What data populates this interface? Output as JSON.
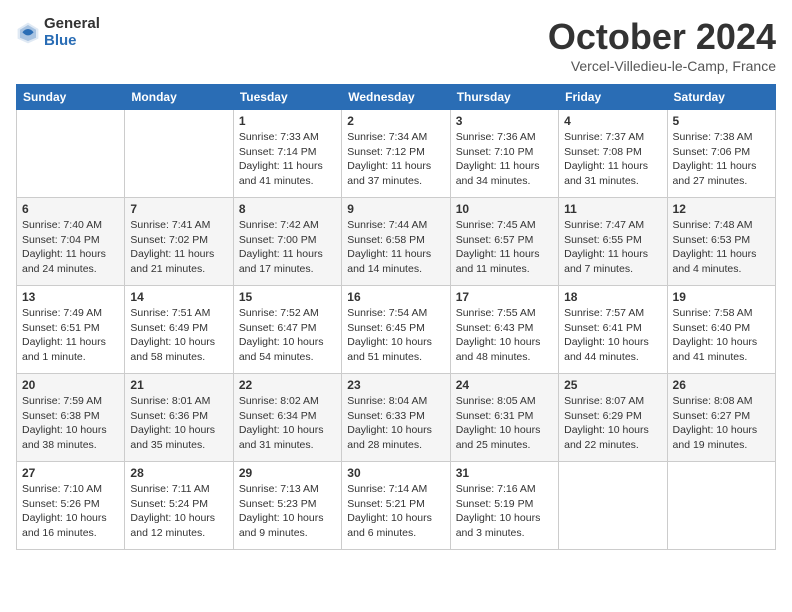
{
  "header": {
    "logo_general": "General",
    "logo_blue": "Blue",
    "month_title": "October 2024",
    "location": "Vercel-Villedieu-le-Camp, France"
  },
  "columns": [
    "Sunday",
    "Monday",
    "Tuesday",
    "Wednesday",
    "Thursday",
    "Friday",
    "Saturday"
  ],
  "weeks": [
    [
      {
        "day": "",
        "info": ""
      },
      {
        "day": "",
        "info": ""
      },
      {
        "day": "1",
        "info": "Sunrise: 7:33 AM\nSunset: 7:14 PM\nDaylight: 11 hours and 41 minutes."
      },
      {
        "day": "2",
        "info": "Sunrise: 7:34 AM\nSunset: 7:12 PM\nDaylight: 11 hours and 37 minutes."
      },
      {
        "day": "3",
        "info": "Sunrise: 7:36 AM\nSunset: 7:10 PM\nDaylight: 11 hours and 34 minutes."
      },
      {
        "day": "4",
        "info": "Sunrise: 7:37 AM\nSunset: 7:08 PM\nDaylight: 11 hours and 31 minutes."
      },
      {
        "day": "5",
        "info": "Sunrise: 7:38 AM\nSunset: 7:06 PM\nDaylight: 11 hours and 27 minutes."
      }
    ],
    [
      {
        "day": "6",
        "info": "Sunrise: 7:40 AM\nSunset: 7:04 PM\nDaylight: 11 hours and 24 minutes."
      },
      {
        "day": "7",
        "info": "Sunrise: 7:41 AM\nSunset: 7:02 PM\nDaylight: 11 hours and 21 minutes."
      },
      {
        "day": "8",
        "info": "Sunrise: 7:42 AM\nSunset: 7:00 PM\nDaylight: 11 hours and 17 minutes."
      },
      {
        "day": "9",
        "info": "Sunrise: 7:44 AM\nSunset: 6:58 PM\nDaylight: 11 hours and 14 minutes."
      },
      {
        "day": "10",
        "info": "Sunrise: 7:45 AM\nSunset: 6:57 PM\nDaylight: 11 hours and 11 minutes."
      },
      {
        "day": "11",
        "info": "Sunrise: 7:47 AM\nSunset: 6:55 PM\nDaylight: 11 hours and 7 minutes."
      },
      {
        "day": "12",
        "info": "Sunrise: 7:48 AM\nSunset: 6:53 PM\nDaylight: 11 hours and 4 minutes."
      }
    ],
    [
      {
        "day": "13",
        "info": "Sunrise: 7:49 AM\nSunset: 6:51 PM\nDaylight: 11 hours and 1 minute."
      },
      {
        "day": "14",
        "info": "Sunrise: 7:51 AM\nSunset: 6:49 PM\nDaylight: 10 hours and 58 minutes."
      },
      {
        "day": "15",
        "info": "Sunrise: 7:52 AM\nSunset: 6:47 PM\nDaylight: 10 hours and 54 minutes."
      },
      {
        "day": "16",
        "info": "Sunrise: 7:54 AM\nSunset: 6:45 PM\nDaylight: 10 hours and 51 minutes."
      },
      {
        "day": "17",
        "info": "Sunrise: 7:55 AM\nSunset: 6:43 PM\nDaylight: 10 hours and 48 minutes."
      },
      {
        "day": "18",
        "info": "Sunrise: 7:57 AM\nSunset: 6:41 PM\nDaylight: 10 hours and 44 minutes."
      },
      {
        "day": "19",
        "info": "Sunrise: 7:58 AM\nSunset: 6:40 PM\nDaylight: 10 hours and 41 minutes."
      }
    ],
    [
      {
        "day": "20",
        "info": "Sunrise: 7:59 AM\nSunset: 6:38 PM\nDaylight: 10 hours and 38 minutes."
      },
      {
        "day": "21",
        "info": "Sunrise: 8:01 AM\nSunset: 6:36 PM\nDaylight: 10 hours and 35 minutes."
      },
      {
        "day": "22",
        "info": "Sunrise: 8:02 AM\nSunset: 6:34 PM\nDaylight: 10 hours and 31 minutes."
      },
      {
        "day": "23",
        "info": "Sunrise: 8:04 AM\nSunset: 6:33 PM\nDaylight: 10 hours and 28 minutes."
      },
      {
        "day": "24",
        "info": "Sunrise: 8:05 AM\nSunset: 6:31 PM\nDaylight: 10 hours and 25 minutes."
      },
      {
        "day": "25",
        "info": "Sunrise: 8:07 AM\nSunset: 6:29 PM\nDaylight: 10 hours and 22 minutes."
      },
      {
        "day": "26",
        "info": "Sunrise: 8:08 AM\nSunset: 6:27 PM\nDaylight: 10 hours and 19 minutes."
      }
    ],
    [
      {
        "day": "27",
        "info": "Sunrise: 7:10 AM\nSunset: 5:26 PM\nDaylight: 10 hours and 16 minutes."
      },
      {
        "day": "28",
        "info": "Sunrise: 7:11 AM\nSunset: 5:24 PM\nDaylight: 10 hours and 12 minutes."
      },
      {
        "day": "29",
        "info": "Sunrise: 7:13 AM\nSunset: 5:23 PM\nDaylight: 10 hours and 9 minutes."
      },
      {
        "day": "30",
        "info": "Sunrise: 7:14 AM\nSunset: 5:21 PM\nDaylight: 10 hours and 6 minutes."
      },
      {
        "day": "31",
        "info": "Sunrise: 7:16 AM\nSunset: 5:19 PM\nDaylight: 10 hours and 3 minutes."
      },
      {
        "day": "",
        "info": ""
      },
      {
        "day": "",
        "info": ""
      }
    ]
  ]
}
